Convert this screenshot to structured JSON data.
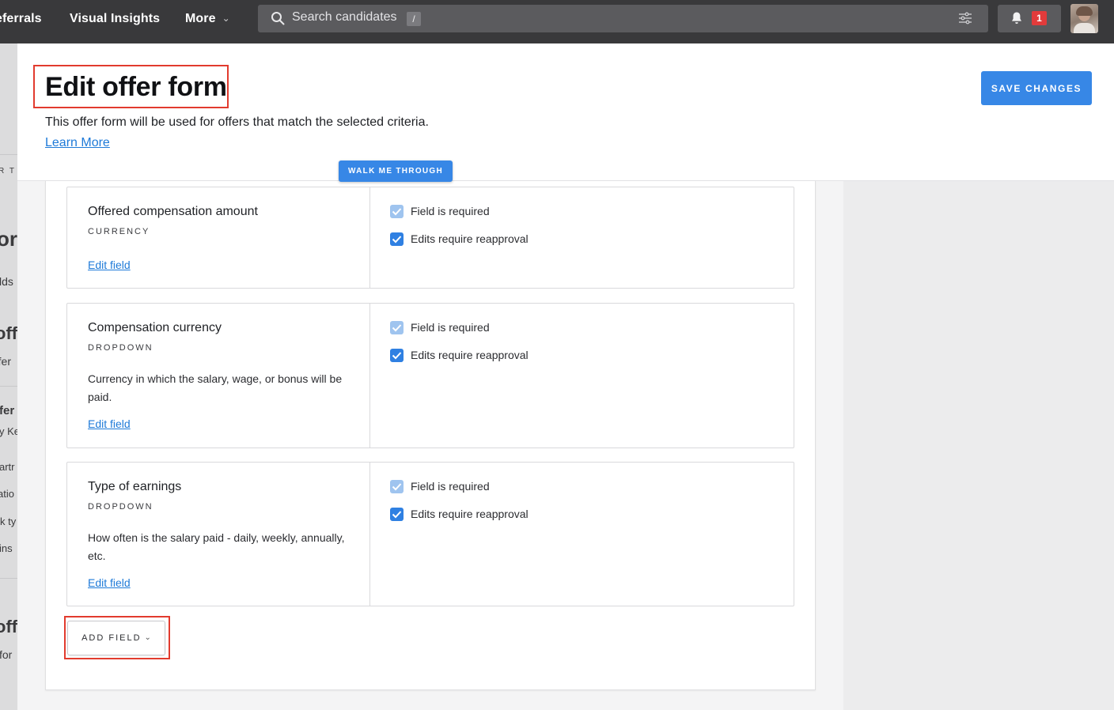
{
  "nav": {
    "referrals": "eferrals",
    "visual_insights": "Visual Insights",
    "more": "More",
    "search_placeholder": "Search candidates",
    "search_shortcut": "/",
    "notification_count": "1"
  },
  "background_page": {
    "fragments": [
      "R T",
      "or",
      "lds",
      "off",
      "ffer",
      "ffer",
      "y Ke",
      "artr",
      "atio",
      "k ty",
      "ins",
      "off",
      "for"
    ]
  },
  "header": {
    "title": "Edit offer form",
    "subtitle": "This offer form will be used for offers that match the selected criteria.",
    "learn_more": "Learn More",
    "save_button": "SAVE CHANGES"
  },
  "walk_me_through": "WALK ME THROUGH",
  "fields": [
    {
      "name": "Offered compensation amount",
      "type": "CURRENCY",
      "description": "",
      "edit_label": "Edit field",
      "required_label": "Field is required",
      "reapproval_label": "Edits require reapproval",
      "required_checked": true,
      "reapproval_checked": true
    },
    {
      "name": "Compensation currency",
      "type": "DROPDOWN",
      "description": "Currency in which the salary, wage, or bonus will be paid.",
      "edit_label": "Edit field",
      "required_label": "Field is required",
      "reapproval_label": "Edits require reapproval",
      "required_checked": true,
      "reapproval_checked": true
    },
    {
      "name": "Type of earnings",
      "type": "DROPDOWN",
      "description": "How often is the salary paid - daily, weekly, annually, etc.",
      "edit_label": "Edit field",
      "required_label": "Field is required",
      "reapproval_label": "Edits require reapproval",
      "required_checked": true,
      "reapproval_checked": true
    }
  ],
  "add_field_button": "ADD FIELD",
  "colors": {
    "topbar": "#39393b",
    "primary": "#3787e6",
    "link": "#1e7ad8",
    "highlight": "#e23b2e",
    "badge": "#e23b3b"
  }
}
